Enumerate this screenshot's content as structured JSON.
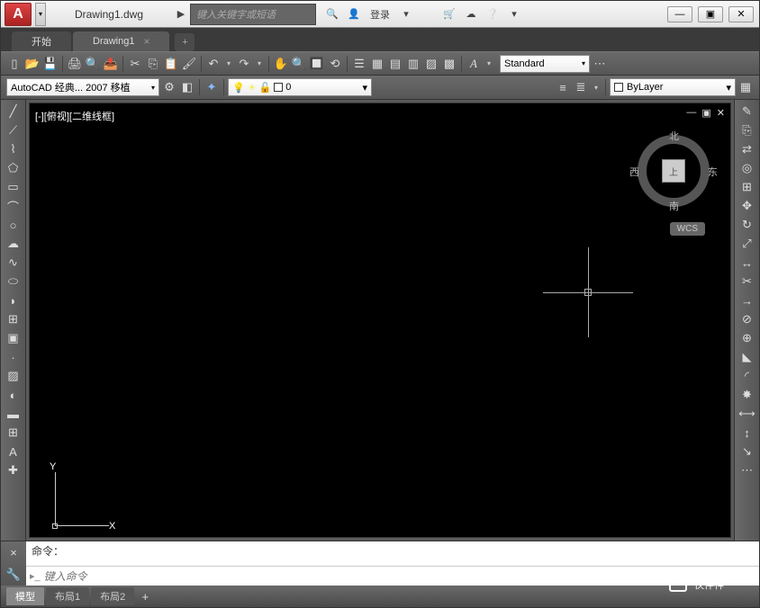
{
  "app_letter": "A",
  "title": "Drawing1.dwg",
  "search_placeholder": "键入关键字或短语",
  "login_label": "登录",
  "window_buttons": [
    "—",
    "▣",
    "✕"
  ],
  "file_tabs": {
    "tabs": [
      {
        "label": "开始",
        "active": false
      },
      {
        "label": "Drawing1",
        "active": true
      }
    ]
  },
  "style_dropdown": "Standard",
  "workspace_dropdown": "AutoCAD 经典... 2007 移植",
  "layer_current": "0",
  "color_dropdown": "ByLayer",
  "viewport_label": "[-][俯视][二维线框]",
  "compass": {
    "n": "北",
    "s": "南",
    "e": "东",
    "w": "西",
    "top": "上"
  },
  "wcs_label": "WCS",
  "ucs": {
    "x": "X",
    "y": "Y"
  },
  "cmd_history": "命令：",
  "cmd_placeholder": "键入命令",
  "bottom_tabs": [
    {
      "label": "模型",
      "active": true
    },
    {
      "label": "布局1",
      "active": false
    },
    {
      "label": "布局2",
      "active": false
    }
  ],
  "watermark": "伙伴神"
}
